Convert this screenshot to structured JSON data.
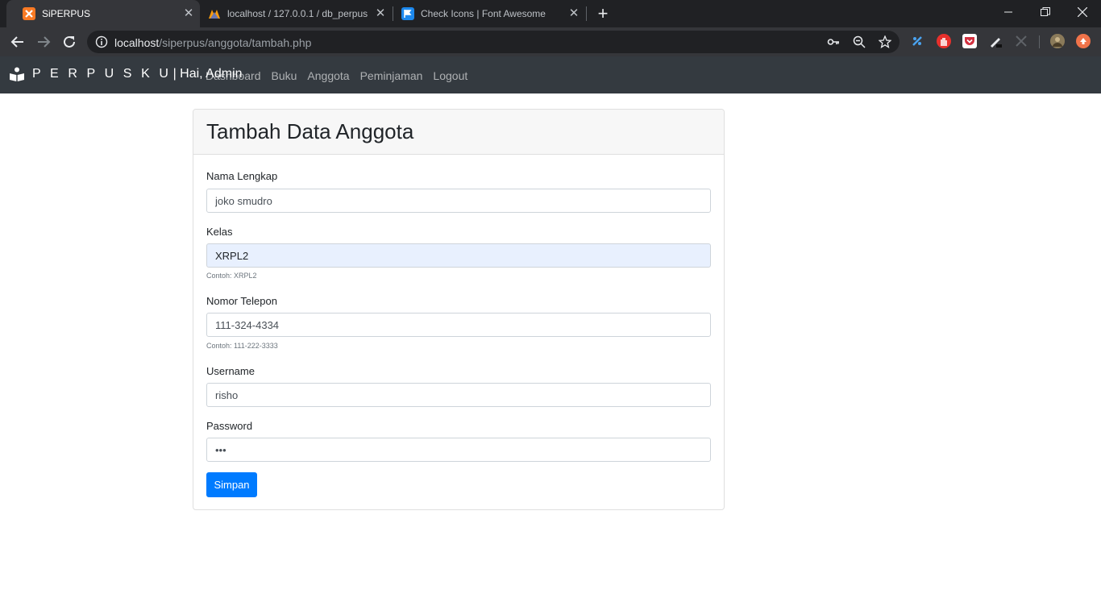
{
  "browser": {
    "tabs": [
      {
        "title": "SiPERPUS",
        "favicon": "xampp-icon",
        "color": "#fb7a24",
        "active": true
      },
      {
        "title": "localhost / 127.0.0.1 / db_perpus",
        "favicon": "phpmyadmin-icon",
        "color": "#f89c0e",
        "active": false
      },
      {
        "title": "Check Icons | Font Awesome",
        "favicon": "flag-icon",
        "color": "#1c88ed",
        "active": false
      }
    ],
    "url_host": "localhost",
    "url_path": "/siperpus/anggota/tambah.php"
  },
  "navbar": {
    "brand": "P E R P U S K U",
    "greeting": "| Hai, Admin",
    "links": [
      "Dashboard",
      "Buku",
      "Anggota",
      "Peminjaman",
      "Logout"
    ]
  },
  "form": {
    "title": "Tambah Data Anggota",
    "nama": {
      "label": "Nama Lengkap",
      "value": "joko smudro"
    },
    "kelas": {
      "label": "Kelas",
      "value": "XRPL2",
      "help": "Contoh: XRPL2"
    },
    "telepon": {
      "label": "Nomor Telepon",
      "value": "111-324-4334",
      "help": "Contoh: 111-222-3333"
    },
    "username": {
      "label": "Username",
      "value": "risho"
    },
    "password": {
      "label": "Password",
      "value": "•••"
    },
    "submit_label": "Simpan"
  },
  "colors": {
    "navbar_bg": "#343a40",
    "primary": "#007bff",
    "autofill_bg": "#e8f0fe"
  }
}
